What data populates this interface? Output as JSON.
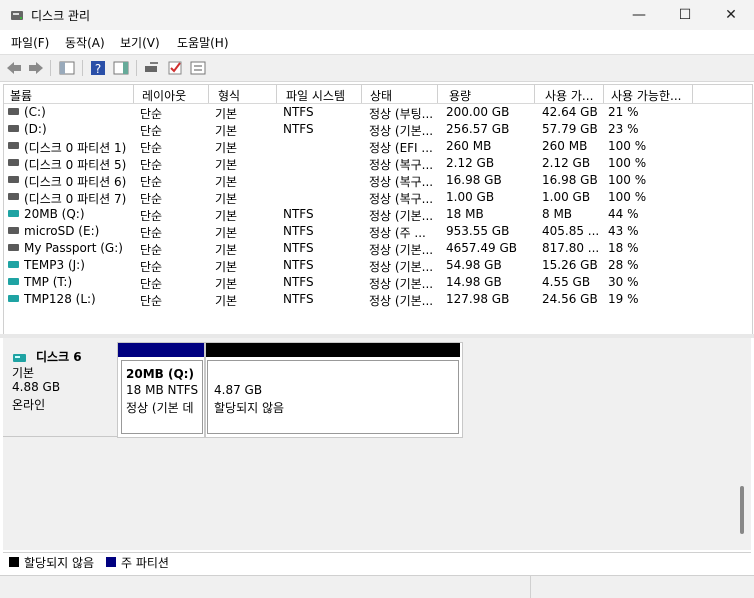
{
  "window": {
    "title": "디스크 관리",
    "minimize": "—",
    "maximize": "☐",
    "close": "✕"
  },
  "menu": [
    "파일(F)",
    "동작(A)",
    "보기(V)",
    "도움말(H)"
  ],
  "toolbar": {
    "icons": [
      "back-arrow-icon",
      "forward-arrow-icon",
      "show-hide-console-tree-icon",
      "help-icon",
      "show-hide-action-pane-icon",
      "connect-drive-icon",
      "check-icon",
      "properties-icon"
    ]
  },
  "volumes": {
    "columns": [
      "볼륨",
      "레이아웃",
      "형식",
      "파일 시스템",
      "상태",
      "용량",
      "사용 가...",
      "사용 가능한..."
    ],
    "rows": [
      {
        "name": "(C:)",
        "layout": "단순",
        "type": "기본",
        "fs": "NTFS",
        "status": "정상 (부팅...",
        "capacity": "200.00 GB",
        "free": "42.64 GB",
        "pct": "21 %",
        "icon": "gray"
      },
      {
        "name": "(D:)",
        "layout": "단순",
        "type": "기본",
        "fs": "NTFS",
        "status": "정상 (기본...",
        "capacity": "256.57 GB",
        "free": "57.79 GB",
        "pct": "23 %",
        "icon": "gray"
      },
      {
        "name": "(디스크 0 파티션 1)",
        "layout": "단순",
        "type": "기본",
        "fs": "",
        "status": "정상 (EFI ...",
        "capacity": "260 MB",
        "free": "260 MB",
        "pct": "100 %",
        "icon": "gray"
      },
      {
        "name": "(디스크 0 파티션 5)",
        "layout": "단순",
        "type": "기본",
        "fs": "",
        "status": "정상 (복구...",
        "capacity": "2.12 GB",
        "free": "2.12 GB",
        "pct": "100 %",
        "icon": "gray"
      },
      {
        "name": "(디스크 0 파티션 6)",
        "layout": "단순",
        "type": "기본",
        "fs": "",
        "status": "정상 (복구...",
        "capacity": "16.98 GB",
        "free": "16.98 GB",
        "pct": "100 %",
        "icon": "gray"
      },
      {
        "name": "(디스크 0 파티션 7)",
        "layout": "단순",
        "type": "기본",
        "fs": "",
        "status": "정상 (복구...",
        "capacity": "1.00 GB",
        "free": "1.00 GB",
        "pct": "100 %",
        "icon": "gray"
      },
      {
        "name": "20MB (Q:)",
        "layout": "단순",
        "type": "기본",
        "fs": "NTFS",
        "status": "정상 (기본...",
        "capacity": "18 MB",
        "free": "8 MB",
        "pct": "44 %",
        "icon": "teal"
      },
      {
        "name": "microSD (E:)",
        "layout": "단순",
        "type": "기본",
        "fs": "NTFS",
        "status": "정상 (주 ...",
        "capacity": "953.55 GB",
        "free": "405.85 ...",
        "pct": "43 %",
        "icon": "gray"
      },
      {
        "name": "My Passport (G:)",
        "layout": "단순",
        "type": "기본",
        "fs": "NTFS",
        "status": "정상 (기본...",
        "capacity": "4657.49 GB",
        "free": "817.80 ...",
        "pct": "18 %",
        "icon": "gray"
      },
      {
        "name": "TEMP3 (J:)",
        "layout": "단순",
        "type": "기본",
        "fs": "NTFS",
        "status": "정상 (기본...",
        "capacity": "54.98 GB",
        "free": "15.26 GB",
        "pct": "28 %",
        "icon": "teal"
      },
      {
        "name": "TMP (T:)",
        "layout": "단순",
        "type": "기본",
        "fs": "NTFS",
        "status": "정상 (기본...",
        "capacity": "14.98 GB",
        "free": "4.55 GB",
        "pct": "30 %",
        "icon": "teal"
      },
      {
        "name": "TMP128 (L:)",
        "layout": "단순",
        "type": "기본",
        "fs": "NTFS",
        "status": "정상 (기본...",
        "capacity": "127.98 GB",
        "free": "24.56 GB",
        "pct": "19 %",
        "icon": "teal"
      }
    ]
  },
  "disk": {
    "name": "디스크 6",
    "type": "기본",
    "size": "4.88 GB",
    "state": "온라인",
    "partitions": [
      {
        "title": "20MB  (Q:)",
        "line1": "18 MB NTFS",
        "line2": "정상 (기본 데",
        "color": "#000080"
      },
      {
        "title": "",
        "line1": "4.87 GB",
        "line2": "할당되지 않음",
        "color": "#000000"
      }
    ]
  },
  "legend": {
    "items": [
      {
        "label": "할당되지 않음",
        "color": "#000000"
      },
      {
        "label": "주 파티션",
        "color": "#000080"
      }
    ]
  },
  "colors": {
    "teal": "#1fa3a3",
    "gray": "#5a5a5a",
    "primary": "#000080",
    "unallocated": "#000000"
  }
}
